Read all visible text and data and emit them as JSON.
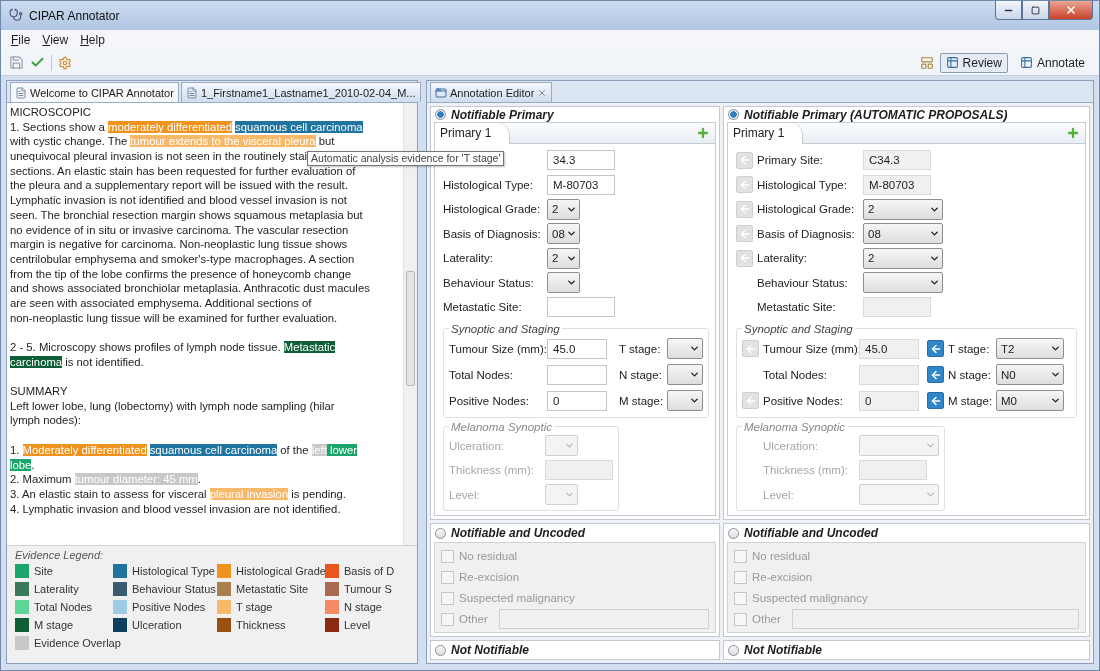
{
  "window": {
    "title": "CIPAR Annotator"
  },
  "menu": [
    "File",
    "View",
    "Help"
  ],
  "perspectives": [
    {
      "label": "Review",
      "selected": true
    },
    {
      "label": "Annotate",
      "selected": false
    }
  ],
  "document_tabs": [
    {
      "label": "Welcome to CIPAR Annotator",
      "selected": false
    },
    {
      "label": "1_Firstname1_Lastname1_2010-02-04_M...",
      "selected": true
    }
  ],
  "document": {
    "lines": [
      {
        "kind": "text",
        "segments": [
          {
            "text": "MICROSCOPIC"
          }
        ]
      },
      {
        "kind": "text",
        "segments": [
          {
            "text": "1. Sections show a "
          },
          {
            "text": "moderately differentiated",
            "color": "#f0931e"
          },
          {
            "text": "squamous cell carcinoma",
            "color": "#1f74a0"
          }
        ]
      },
      {
        "kind": "text",
        "segments": [
          {
            "text": "with cystic change. The "
          },
          {
            "text": "tumour extends to the visceral pleura",
            "color": "#f7b86a"
          },
          {
            "text": " but"
          }
        ]
      },
      {
        "kind": "text",
        "segments": [
          {
            "text": "unequivocal pleural invasion is not seen in the routinely stai"
          }
        ],
        "tooltip": "Automatic analysis evidence for 'T stage'"
      },
      {
        "kind": "text",
        "segments": [
          {
            "text": "sections. An elastic stain has been requested for further evaluation of"
          }
        ]
      },
      {
        "kind": "text",
        "segments": [
          {
            "text": "the pleura and a supplementary report will be issued with the result."
          }
        ]
      },
      {
        "kind": "text",
        "segments": [
          {
            "text": "Lymphatic invasion is not identified and blood vessel invasion is not"
          }
        ]
      },
      {
        "kind": "text",
        "segments": [
          {
            "text": "seen. The bronchial resection margin shows squamous metaplasia but"
          }
        ]
      },
      {
        "kind": "text",
        "segments": [
          {
            "text": "no evidence of in situ or invasive carcinoma. The vascular resection"
          }
        ]
      },
      {
        "kind": "text",
        "segments": [
          {
            "text": "margin is negative for carcinoma. Non-neoplastic lung tissue shows"
          }
        ]
      },
      {
        "kind": "text",
        "segments": [
          {
            "text": "centrilobular emphysema and smoker's-type macrophages. A section"
          }
        ]
      },
      {
        "kind": "text",
        "segments": [
          {
            "text": "from the tip of the lobe confirms the presence of honeycomb change"
          }
        ]
      },
      {
        "kind": "text",
        "segments": [
          {
            "text": "and shows associated bronchiolar metaplasia. Anthracotic dust macules"
          }
        ]
      },
      {
        "kind": "text",
        "segments": [
          {
            "text": "are seen with associated emphysema. Additional sections of"
          }
        ]
      },
      {
        "kind": "text",
        "segments": [
          {
            "text": "non-neoplastic lung tissue will be examined for further evaluation."
          }
        ]
      },
      {
        "kind": "gap"
      },
      {
        "kind": "text",
        "segments": [
          {
            "text": "2 - 5. Microscopy shows profiles of lymph node tissue. "
          },
          {
            "text": "Metastatic",
            "color": "#0e5e36"
          }
        ]
      },
      {
        "kind": "text",
        "segments": [
          {
            "text": "carcinoma",
            "color": "#0e5e36"
          },
          {
            "text": " is not identified."
          }
        ]
      },
      {
        "kind": "gap"
      },
      {
        "kind": "text",
        "segments": [
          {
            "text": "SUMMARY"
          }
        ]
      },
      {
        "kind": "text",
        "segments": [
          {
            "text": "Left lower lobe, lung (lobectomy) with lymph node sampling (hilar"
          }
        ]
      },
      {
        "kind": "text",
        "segments": [
          {
            "text": "lymph nodes):"
          }
        ]
      },
      {
        "kind": "gap"
      },
      {
        "kind": "text",
        "segments": [
          {
            "text": "1. "
          },
          {
            "text": "Moderately differentiated",
            "color": "#f0931e"
          },
          {
            "text": "squamous cell carcinoma",
            "color": "#1f74a0"
          },
          {
            "text": " of the "
          },
          {
            "text": "left",
            "color": "#c8c8c8"
          },
          {
            "text": " lower",
            "color": "#1aa56a"
          }
        ]
      },
      {
        "kind": "text",
        "segments": [
          {
            "text": "lobe",
            "color": "#1aa56a"
          },
          {
            "text": "."
          }
        ]
      },
      {
        "kind": "text",
        "segments": [
          {
            "text": "2. Maximum "
          },
          {
            "text": "tumour diameter: 45 mm",
            "color": "#c8c8c8"
          },
          {
            "text": "."
          }
        ]
      },
      {
        "kind": "text",
        "segments": [
          {
            "text": "3. An elastic stain to assess for visceral "
          },
          {
            "text": "pleural invasion",
            "color": "#f7b86a"
          },
          {
            "text": " is pending."
          }
        ]
      },
      {
        "kind": "text",
        "segments": [
          {
            "text": "4. Lymphatic invasion and blood vessel invasion are not identified."
          }
        ]
      }
    ]
  },
  "legend": {
    "title": "Evidence Legend:",
    "items": [
      {
        "label": "Site",
        "color": "#1aa56a"
      },
      {
        "label": "Histological Type",
        "color": "#1f74a0"
      },
      {
        "label": "Histological Grade",
        "color": "#f0931e"
      },
      {
        "label": "Basis of D",
        "color": "#e8561e"
      },
      {
        "label": "Laterality",
        "color": "#3a7a5a"
      },
      {
        "label": "Behaviour Status",
        "color": "#3a5a70"
      },
      {
        "label": "Metastatic Site",
        "color": "#a87e4a"
      },
      {
        "label": "Tumour S",
        "color": "#a86a50"
      },
      {
        "label": "Total Nodes",
        "color": "#5ed69a"
      },
      {
        "label": "Positive Nodes",
        "color": "#9ccbe3"
      },
      {
        "label": "T stage",
        "color": "#f7b86a"
      },
      {
        "label": "N stage",
        "color": "#f48a66"
      },
      {
        "label": "M stage",
        "color": "#0e5e36"
      },
      {
        "label": "Ulceration",
        "color": "#0c3f60"
      },
      {
        "label": "Thickness",
        "color": "#9a5010"
      },
      {
        "label": "Level",
        "color": "#8a2a10"
      },
      {
        "label": "Evidence Overlap",
        "color": "#c8c8c8"
      }
    ]
  },
  "editor_tab": {
    "label": "Annotation Editor"
  },
  "editor": {
    "columns": [
      {
        "readonly": false,
        "primary": {
          "title": "Notifiable Primary",
          "selected": true,
          "tab": "Primary 1",
          "rows": [
            {
              "kind": "field",
              "value": "34.3"
            },
            {
              "kind": "field",
              "label": "Histological Type:",
              "value": "M-80703"
            },
            {
              "kind": "select",
              "label": "Histological Grade:",
              "value": "2"
            },
            {
              "kind": "select",
              "label": "Basis of Diagnosis:",
              "value": "08"
            },
            {
              "kind": "select",
              "label": "Laterality:",
              "value": "2"
            },
            {
              "kind": "select",
              "label": "Behaviour Status:"
            },
            {
              "kind": "field",
              "label": "Metastatic Site:"
            }
          ],
          "staging": {
            "title": "Synoptic and Staging",
            "rows": [
              {
                "left": {
                  "kind": "field",
                  "label": "Tumour Size (mm):",
                  "value": "45.0"
                },
                "right": {
                  "kind": "select",
                  "label": "T stage:"
                }
              },
              {
                "left": {
                  "kind": "field",
                  "label": "Total Nodes:"
                },
                "right": {
                  "kind": "select",
                  "label": "N stage:"
                }
              },
              {
                "left": {
                  "kind": "field",
                  "label": "Positive Nodes:",
                  "value": "0"
                },
                "right": {
                  "kind": "select",
                  "label": "M stage:"
                }
              }
            ]
          },
          "melanoma": {
            "title": "Melanoma Synoptic",
            "disabled": true,
            "rows": [
              {
                "kind": "select",
                "label": "Ulceration:"
              },
              {
                "kind": "field",
                "label": "Thickness (mm):"
              },
              {
                "kind": "select",
                "label": "Level:"
              }
            ]
          }
        },
        "uncoded": {
          "title": "Notifiable and Uncoded",
          "selected": false,
          "options": [
            {
              "label": "No residual",
              "checked": false,
              "disabled": true
            },
            {
              "label": "Re-excision",
              "checked": false,
              "disabled": true
            },
            {
              "label": "Suspected malignancy",
              "checked": false,
              "disabled": true
            }
          ],
          "other": {
            "label": "Other",
            "checked": false,
            "disabled": true
          }
        },
        "not_notifiable": {
          "title": "Not Notifiable",
          "selected": false
        }
      },
      {
        "readonly": true,
        "primary": {
          "title": "Notifiable Primary (AUTOMATIC PROPOSALS)",
          "selected": true,
          "tab": "Primary 1",
          "rows": [
            {
              "kind": "field",
              "label": "Primary Site:",
              "value": "C34.3",
              "evidence": {
                "kind": "button",
                "active": false
              }
            },
            {
              "kind": "field",
              "label": "Histological Type:",
              "value": "M-80703",
              "evidence": {
                "kind": "button",
                "active": false
              }
            },
            {
              "kind": "select",
              "label": "Histological Grade:",
              "value": "2",
              "evidence": {
                "kind": "button",
                "active": false
              }
            },
            {
              "kind": "select",
              "label": "Basis of Diagnosis:",
              "value": "08",
              "evidence": {
                "kind": "button",
                "active": false
              }
            },
            {
              "kind": "select",
              "label": "Laterality:",
              "value": "2",
              "evidence": {
                "kind": "button",
                "active": false
              }
            },
            {
              "kind": "select",
              "label": "Behaviour Status:",
              "evidence": {
                "kind": "blank"
              }
            },
            {
              "kind": "field",
              "label": "Metastatic Site:",
              "evidence": {
                "kind": "blank"
              }
            }
          ],
          "staging": {
            "title": "Synoptic and Staging",
            "rows": [
              {
                "left": {
                  "kind": "field",
                  "label": "Tumour Size (mm):",
                  "value": "45.0",
                  "evidence": {
                    "kind": "button",
                    "active": false
                  }
                },
                "right": {
                  "kind": "select",
                  "label": "T stage:",
                  "value": "T2",
                  "evidence": {
                    "kind": "button",
                    "active": true
                  }
                }
              },
              {
                "left": {
                  "kind": "field",
                  "label": "Total Nodes:",
                  "evidence": {
                    "kind": "blank"
                  }
                },
                "right": {
                  "kind": "select",
                  "label": "N stage:",
                  "value": "N0",
                  "evidence": {
                    "kind": "button",
                    "active": true
                  }
                }
              },
              {
                "left": {
                  "kind": "field",
                  "label": "Positive Nodes:",
                  "value": "0",
                  "evidence": {
                    "kind": "button",
                    "active": false
                  }
                },
                "right": {
                  "kind": "select",
                  "label": "M stage:",
                  "value": "M0",
                  "evidence": {
                    "kind": "button",
                    "active": true
                  }
                }
              }
            ]
          },
          "melanoma": {
            "title": "Melanoma Synoptic",
            "disabled": true,
            "rows": [
              {
                "kind": "select",
                "label": "Ulceration:",
                "evidence": {
                  "kind": "blank"
                }
              },
              {
                "kind": "field",
                "label": "Thickness (mm):",
                "evidence": {
                  "kind": "blank"
                }
              },
              {
                "kind": "select",
                "label": "Level:",
                "evidence": {
                  "kind": "blank"
                }
              }
            ]
          }
        },
        "uncoded": {
          "title": "Notifiable and Uncoded",
          "selected": false,
          "options": [
            {
              "label": "No residual",
              "checked": false,
              "disabled": true
            },
            {
              "label": "Re-excision",
              "checked": false,
              "disabled": true
            },
            {
              "label": "Suspected malignancy",
              "checked": false,
              "disabled": true
            }
          ],
          "other": {
            "label": "Other",
            "checked": false,
            "disabled": true
          }
        },
        "not_notifiable": {
          "title": "Not Notifiable",
          "selected": false
        }
      }
    ]
  }
}
